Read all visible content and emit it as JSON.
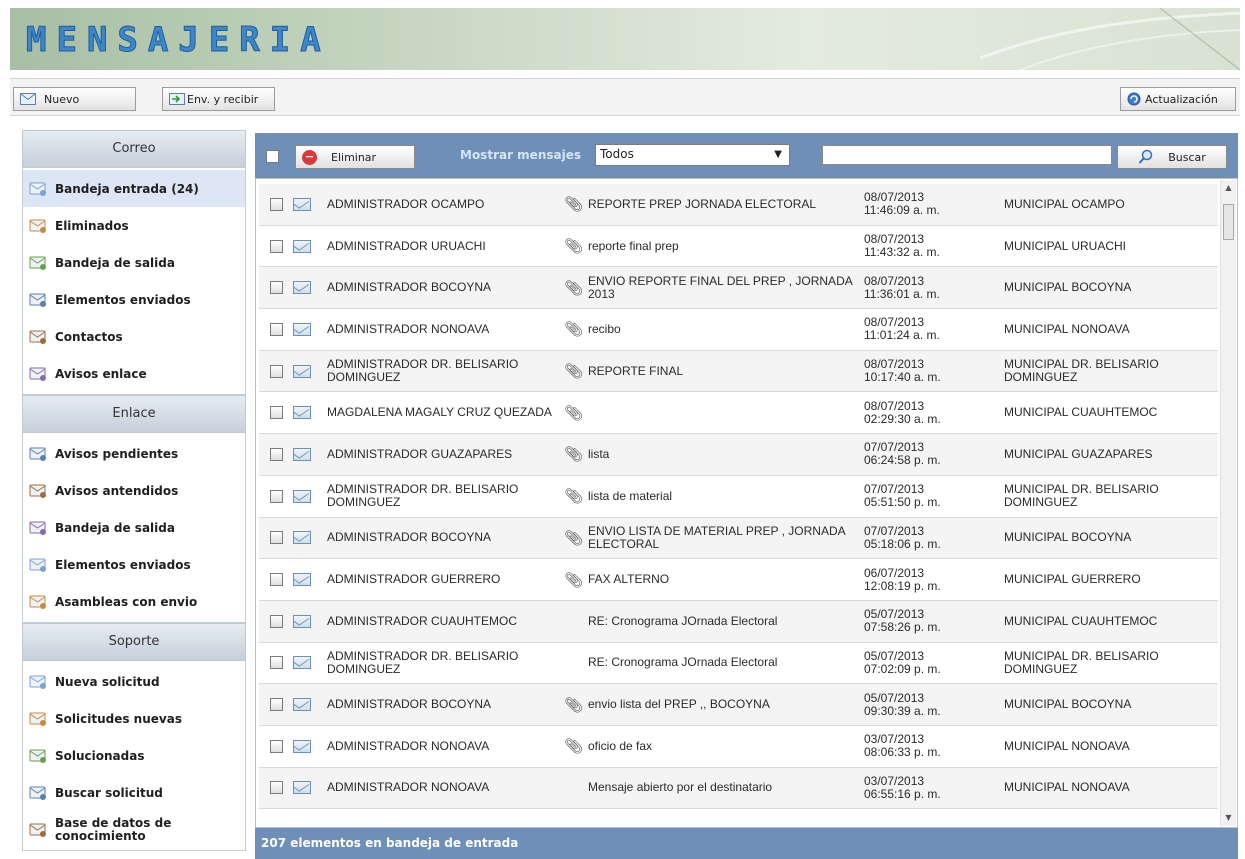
{
  "app": {
    "logo_text": "MENSAJERIA"
  },
  "toolbar": {
    "new_label": "Nuevo",
    "send_receive_label": "Env. y recibir",
    "update_label": "Actualización"
  },
  "sidebar": {
    "sections": [
      {
        "title": "Correo",
        "items": [
          {
            "label": "Bandeja entrada (24)",
            "icon": "envelope-icon"
          },
          {
            "label": "Eliminados",
            "icon": "deleted-mail-icon"
          },
          {
            "label": "Bandeja de salida",
            "icon": "outbox-icon"
          },
          {
            "label": "Elementos enviados",
            "icon": "sent-items-icon"
          },
          {
            "label": "Contactos",
            "icon": "contacts-icon"
          },
          {
            "label": "Avisos enlace",
            "icon": "user-notice-icon"
          }
        ]
      },
      {
        "title": "Enlace",
        "items": [
          {
            "label": "Avisos pendientes",
            "icon": "pending-users-icon"
          },
          {
            "label": "Avisos antendidos",
            "icon": "attended-users-icon"
          },
          {
            "label": "Bandeja de salida",
            "icon": "outbox-icon"
          },
          {
            "label": "Elementos enviados",
            "icon": "sent-items-icon"
          },
          {
            "label": "Asambleas con envio",
            "icon": "assembly-icon"
          }
        ]
      },
      {
        "title": "Soporte",
        "items": [
          {
            "label": "Nueva solicitud",
            "icon": "new-request-icon"
          },
          {
            "label": "Solicitudes nuevas",
            "icon": "new-requests-icon"
          },
          {
            "label": "Solucionadas",
            "icon": "solved-icon"
          },
          {
            "label": "Buscar solicitud",
            "icon": "search-request-icon"
          },
          {
            "label": "Base de datos de conocimiento",
            "icon": "knowledge-base-icon"
          }
        ]
      }
    ]
  },
  "main": {
    "delete_label": "Eliminar",
    "show_messages_label": "Mostrar mensajes",
    "filter_value": "Todos",
    "search_value": "",
    "search_label": "Buscar",
    "status_text": "207 elementos en bandeja de entrada",
    "messages": [
      {
        "from": "ADMINISTRADOR OCAMPO",
        "attach": true,
        "subject": "REPORTE PREP JORNADA ELECTORAL",
        "date": "08/07/2013",
        "time": "11:46:09 a. m.",
        "to": "MUNICIPAL OCAMPO"
      },
      {
        "from": "ADMINISTRADOR URUACHI",
        "attach": true,
        "subject": "reporte final prep",
        "date": "08/07/2013",
        "time": "11:43:32 a. m.",
        "to": "MUNICIPAL URUACHI"
      },
      {
        "from": "ADMINISTRADOR BOCOYNA",
        "attach": true,
        "subject": "ENVIO REPORTE FINAL DEL PREP , JORNADA 2013",
        "date": "08/07/2013",
        "time": "11:36:01 a. m.",
        "to": "MUNICIPAL BOCOYNA"
      },
      {
        "from": "ADMINISTRADOR NONOAVA",
        "attach": true,
        "subject": "recibo",
        "date": "08/07/2013",
        "time": "11:01:24 a. m.",
        "to": "MUNICIPAL NONOAVA"
      },
      {
        "from": "ADMINISTRADOR DR. BELISARIO DOMINGUEZ",
        "attach": true,
        "subject": "REPORTE FINAL",
        "date": "08/07/2013",
        "time": "10:17:40 a. m.",
        "to": "MUNICIPAL DR. BELISARIO DOMINGUEZ"
      },
      {
        "from": "MAGDALENA MAGALY CRUZ QUEZADA",
        "attach": true,
        "subject": "",
        "date": "08/07/2013",
        "time": "02:29:30 a. m.",
        "to": "MUNICIPAL CUAUHTEMOC"
      },
      {
        "from": "ADMINISTRADOR GUAZAPARES",
        "attach": true,
        "subject": "lista",
        "date": "07/07/2013",
        "time": "06:24:58 p. m.",
        "to": "MUNICIPAL GUAZAPARES"
      },
      {
        "from": "ADMINISTRADOR DR. BELISARIO DOMINGUEZ",
        "attach": true,
        "subject": "lista de material",
        "date": "07/07/2013",
        "time": "05:51:50 p. m.",
        "to": "MUNICIPAL DR. BELISARIO DOMINGUEZ"
      },
      {
        "from": "ADMINISTRADOR BOCOYNA",
        "attach": true,
        "subject": "ENVIO LISTA DE MATERIAL PREP , JORNADA ELECTORAL",
        "date": "07/07/2013",
        "time": "05:18:06 p. m.",
        "to": "MUNICIPAL BOCOYNA"
      },
      {
        "from": "ADMINISTRADOR GUERRERO",
        "attach": true,
        "subject": "FAX ALTERNO",
        "date": "06/07/2013",
        "time": "12:08:19 p. m.",
        "to": "MUNICIPAL GUERRERO"
      },
      {
        "from": "ADMINISTRADOR CUAUHTEMOC",
        "attach": false,
        "subject": "RE: Cronograma JOrnada Electoral",
        "date": "05/07/2013",
        "time": "07:58:26 p. m.",
        "to": "MUNICIPAL CUAUHTEMOC"
      },
      {
        "from": "ADMINISTRADOR DR. BELISARIO DOMINGUEZ",
        "attach": false,
        "subject": "RE: Cronograma JOrnada Electoral",
        "date": "05/07/2013",
        "time": "07:02:09 p. m.",
        "to": "MUNICIPAL DR. BELISARIO DOMINGUEZ"
      },
      {
        "from": "ADMINISTRADOR BOCOYNA",
        "attach": true,
        "subject": "envio lista del PREP ,, BOCOYNA",
        "date": "05/07/2013",
        "time": "09:30:39 a. m.",
        "to": "MUNICIPAL BOCOYNA"
      },
      {
        "from": "ADMINISTRADOR NONOAVA",
        "attach": true,
        "subject": "oficio de fax",
        "date": "03/07/2013",
        "time": "08:06:33 p. m.",
        "to": "MUNICIPAL NONOAVA"
      },
      {
        "from": "ADMINISTRADOR NONOAVA",
        "attach": false,
        "subject": "Mensaje abierto por el destinatario",
        "date": "03/07/2013",
        "time": "06:55:16 p. m.",
        "to": "MUNICIPAL NONOAVA"
      }
    ]
  }
}
